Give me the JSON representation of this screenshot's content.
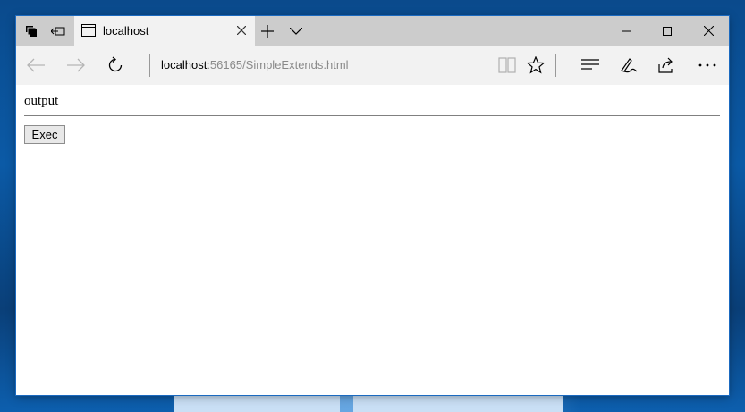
{
  "browser": {
    "tab": {
      "title": "localhost"
    },
    "address": {
      "host": "localhost",
      "path": ":56165/SimpleExtends.html"
    }
  },
  "page": {
    "output_text": "output",
    "exec_label": "Exec"
  }
}
